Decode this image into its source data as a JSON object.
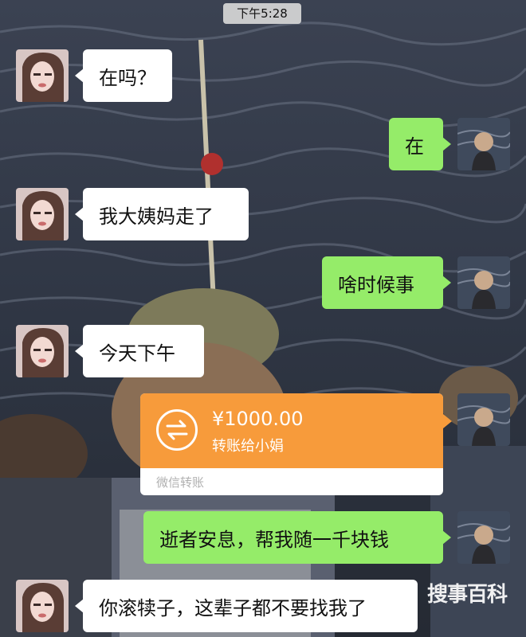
{
  "status": {
    "time": "下午5:28"
  },
  "messages": [
    {
      "side": "in",
      "type": "text",
      "text": "在吗？"
    },
    {
      "side": "out",
      "type": "text",
      "text": "在"
    },
    {
      "side": "in",
      "type": "text",
      "text": "我大姨妈走了"
    },
    {
      "side": "out",
      "type": "text",
      "text": "啥时候事"
    },
    {
      "side": "in",
      "type": "text",
      "text": "今天下午"
    },
    {
      "side": "out",
      "type": "transfer",
      "amount": "¥1000.00",
      "description": "转账给小娟",
      "footer": "微信转账"
    },
    {
      "side": "out",
      "type": "text",
      "text": "逝者安息，帮我随一千块钱"
    },
    {
      "side": "in",
      "type": "text",
      "text": "你滚犊子，这辈子都不要找我了"
    }
  ],
  "watermark": {
    "text": "搜事百科"
  },
  "colors": {
    "incoming_bubble": "#ffffff",
    "outgoing_bubble": "#95ec69",
    "transfer_card": "#f79b3b",
    "transfer_footer_text": "#b0b0b0"
  },
  "icons": {
    "transfer": "transfer-arrows-icon"
  }
}
